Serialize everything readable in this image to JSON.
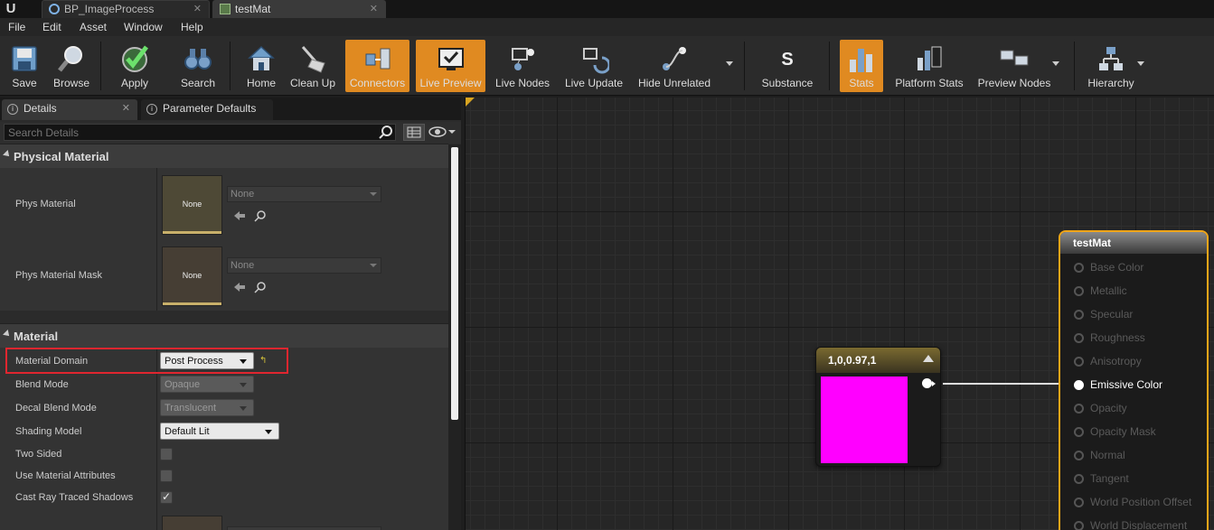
{
  "tabs": [
    {
      "label": "BP_ImageProcess",
      "active": false
    },
    {
      "label": "testMat",
      "active": true
    }
  ],
  "menu": [
    "File",
    "Edit",
    "Asset",
    "Window",
    "Help"
  ],
  "toolbar": {
    "save": "Save",
    "browse": "Browse",
    "apply": "Apply",
    "search": "Search",
    "home": "Home",
    "clean_up": "Clean Up",
    "connectors": "Connectors",
    "live_preview": "Live Preview",
    "live_nodes": "Live Nodes",
    "live_update": "Live Update",
    "hide_unrelated": "Hide Unrelated",
    "substance": "Substance",
    "stats": "Stats",
    "platform_stats": "Platform Stats",
    "preview_nodes": "Preview Nodes",
    "hierarchy": "Hierarchy",
    "active_color": "#e08a21"
  },
  "panel": {
    "tabs": [
      "Details",
      "Parameter Defaults"
    ],
    "search_placeholder": "Search Details",
    "sections": {
      "physical_material": "Physical Material",
      "material": "Material"
    },
    "phys_material": {
      "label": "Phys Material",
      "thumb": "None",
      "value": "None"
    },
    "phys_material_mask": {
      "label": "Phys Material Mask",
      "thumb": "None",
      "value": "None"
    },
    "props": {
      "material_domain": {
        "label": "Material Domain",
        "value": "Post Process"
      },
      "blend_mode": {
        "label": "Blend Mode",
        "value": "Opaque"
      },
      "decal_blend_mode": {
        "label": "Decal Blend Mode",
        "value": "Translucent"
      },
      "shading_model": {
        "label": "Shading Model",
        "value": "Default Lit"
      },
      "two_sided": {
        "label": "Two Sided",
        "checked": false
      },
      "use_material_attributes": {
        "label": "Use Material Attributes",
        "checked": false
      },
      "cast_ray_traced_shadows": {
        "label": "Cast Ray Traced Shadows",
        "checked": true
      }
    },
    "highlight_color": "#e0262f"
  },
  "graph": {
    "constant_node": {
      "title": "1,0,0.97,1",
      "color": "#ff00ff"
    },
    "result_node": {
      "title": "testMat",
      "border_color": "#f0a518",
      "pins": [
        {
          "label": "Base Color",
          "connected": false
        },
        {
          "label": "Metallic",
          "connected": false
        },
        {
          "label": "Specular",
          "connected": false
        },
        {
          "label": "Roughness",
          "connected": false
        },
        {
          "label": "Anisotropy",
          "connected": false
        },
        {
          "label": "Emissive Color",
          "connected": true
        },
        {
          "label": "Opacity",
          "connected": false
        },
        {
          "label": "Opacity Mask",
          "connected": false
        },
        {
          "label": "Normal",
          "connected": false
        },
        {
          "label": "Tangent",
          "connected": false
        },
        {
          "label": "World Position Offset",
          "connected": false
        },
        {
          "label": "World Displacement",
          "connected": false
        }
      ]
    }
  }
}
